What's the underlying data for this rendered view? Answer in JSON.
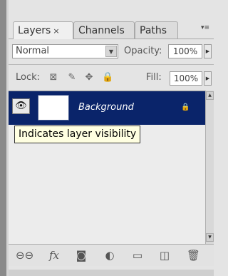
{
  "panel": {
    "tabs": [
      {
        "label": "Layers",
        "close": "×",
        "active": true
      },
      {
        "label": "Channels",
        "active": false
      },
      {
        "label": "Paths",
        "active": false
      }
    ]
  },
  "blend": {
    "mode": "Normal",
    "opacity_label": "Opacity:",
    "opacity_value": "100%"
  },
  "lock": {
    "label": "Lock:",
    "fill_label": "Fill:",
    "fill_value": "100%"
  },
  "layers": [
    {
      "name": "Background",
      "visible": true,
      "locked": true,
      "selected": true
    }
  ],
  "tooltip": "Indicates layer visibility",
  "icons": {
    "lock_transparent": "checker-icon",
    "lock_image": "brush-icon",
    "lock_position": "move-icon",
    "lock_all": "lock-icon",
    "bottom": [
      "link-icon",
      "fx-icon",
      "mask-icon",
      "adjustment-icon",
      "folder-icon",
      "new-layer-icon",
      "trash-icon"
    ]
  },
  "colors": {
    "selection": "#0a246a",
    "tooltip_bg": "#ffffe1"
  }
}
